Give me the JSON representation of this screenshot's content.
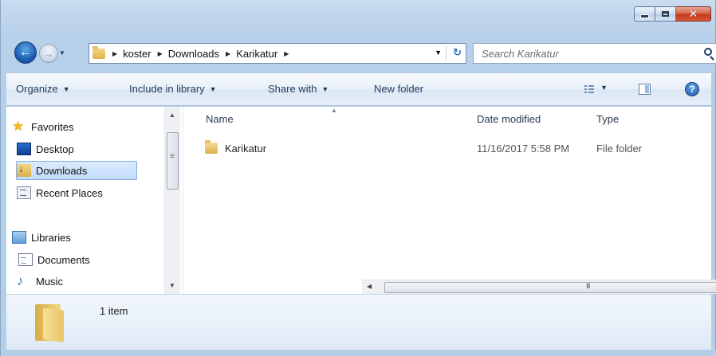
{
  "address": {
    "crumbs": [
      "koster",
      "Downloads",
      "Karikatur"
    ]
  },
  "search": {
    "placeholder": "Search Karikatur"
  },
  "toolbar": {
    "organize": "Organize",
    "include_in_library": "Include in library",
    "share_with": "Share with",
    "new_folder": "New folder"
  },
  "sidebar": {
    "favorites": "Favorites",
    "items": [
      {
        "label": "Desktop",
        "icon": "desktop-icon"
      },
      {
        "label": "Downloads",
        "icon": "downloads-icon",
        "selected": true
      },
      {
        "label": "Recent Places",
        "icon": "recent-places-icon"
      }
    ],
    "libraries": "Libraries",
    "library_items": [
      {
        "label": "Documents",
        "icon": "documents-icon"
      },
      {
        "label": "Music",
        "icon": "music-icon"
      }
    ]
  },
  "columns": {
    "name": "Name",
    "date_modified": "Date modified",
    "type": "Type"
  },
  "files": [
    {
      "name": "Karikatur",
      "date_modified": "11/16/2017 5:58 PM",
      "type": "File folder",
      "icon": "folder-icon"
    }
  ],
  "details": {
    "item_count": "1 item"
  },
  "colors": {
    "accent": "#1c5fb2",
    "selection": "#c1dcfc",
    "close_button": "#c23a1c"
  }
}
